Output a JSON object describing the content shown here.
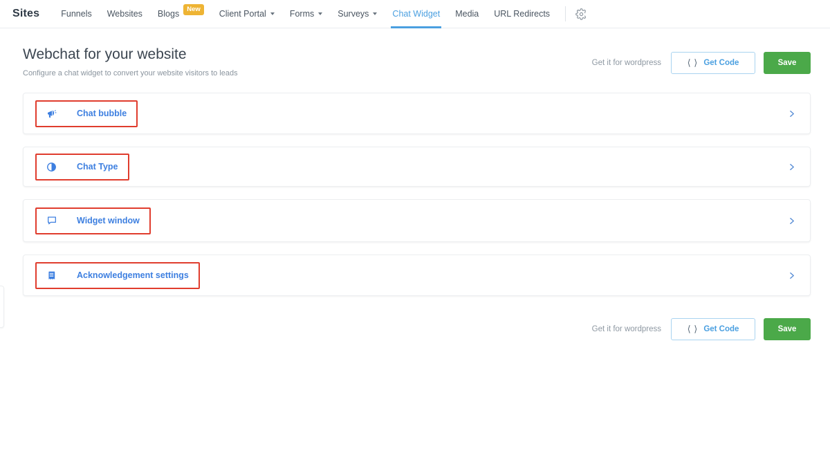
{
  "topnav": {
    "brand": "Sites",
    "items": [
      {
        "label": "Funnels",
        "icon": null,
        "active": false,
        "badge": null
      },
      {
        "label": "Websites",
        "icon": null,
        "active": false,
        "badge": null
      },
      {
        "label": "Blogs",
        "icon": null,
        "active": false,
        "badge": "New"
      },
      {
        "label": "Client Portal",
        "icon": "chevron-down-icon",
        "active": false,
        "badge": null
      },
      {
        "label": "Forms",
        "icon": "chevron-down-icon",
        "active": false,
        "badge": null
      },
      {
        "label": "Surveys",
        "icon": "chevron-down-icon",
        "active": false,
        "badge": null
      },
      {
        "label": "Chat Widget",
        "icon": null,
        "active": true,
        "badge": null
      },
      {
        "label": "Media",
        "icon": null,
        "active": false,
        "badge": null
      },
      {
        "label": "URL Redirects",
        "icon": null,
        "active": false,
        "badge": null
      }
    ],
    "settings_icon": "gear-icon"
  },
  "header": {
    "title": "Webchat for your website",
    "subtitle": "Configure a chat widget to convert your website visitors to leads"
  },
  "actions": {
    "wordpress_text": "Get it for wordpress",
    "get_code_label": "Get Code",
    "get_code_icon": "code-brackets-icon",
    "save_label": "Save"
  },
  "footer_actions": {
    "wordpress_text": "Get it for wordpress",
    "get_code_label": "Get Code",
    "get_code_icon": "code-brackets-icon",
    "save_label": "Save"
  },
  "cards": [
    {
      "label": "Chat bubble",
      "icon": "megaphone-icon",
      "chevron": "chevron-right-icon",
      "highlighted": true
    },
    {
      "label": "Chat Type",
      "icon": "contrast-circle-icon",
      "chevron": "chevron-right-icon",
      "highlighted": true
    },
    {
      "label": "Widget window",
      "icon": "comment-bubble-icon",
      "chevron": "chevron-right-icon",
      "highlighted": true
    },
    {
      "label": "Acknowledgement settings",
      "icon": "receipt-list-icon",
      "chevron": "chevron-right-icon",
      "highlighted": true
    }
  ],
  "colors": {
    "accent_blue": "#3d7fe0",
    "tab_active_blue": "#4a9fe0",
    "save_green": "#4ba949",
    "badge_amber": "#eeb434",
    "highlight_red": "#e03c2d",
    "text_dark": "#3c4651",
    "text_muted": "#8a949e"
  }
}
